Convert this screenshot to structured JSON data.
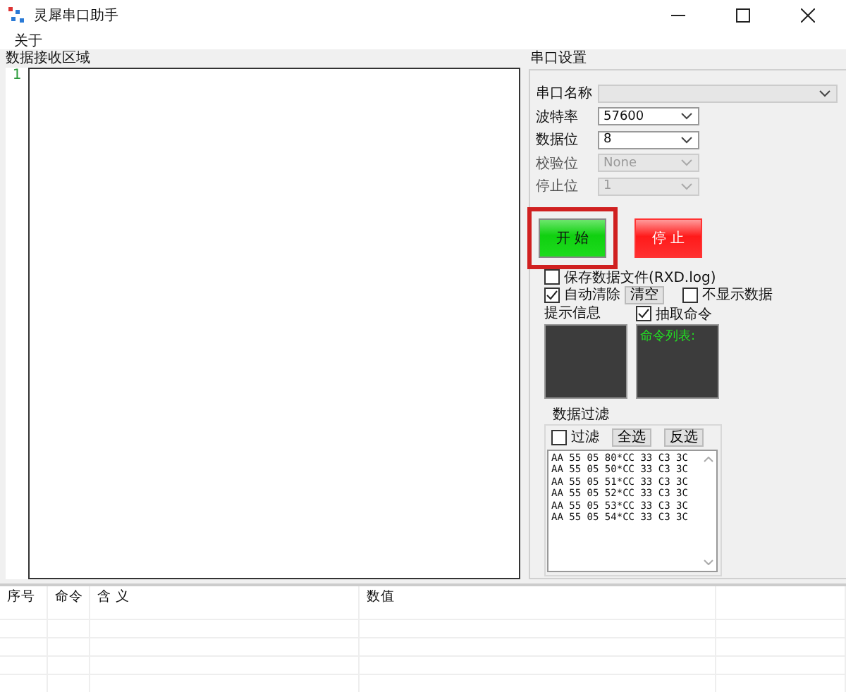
{
  "window": {
    "title": "灵犀串口助手"
  },
  "menu": [
    "关于"
  ],
  "receive": {
    "label": "数据接收区域",
    "line_numbers": [
      "1"
    ]
  },
  "settings": {
    "title": "串口设置",
    "fields": [
      {
        "label": "串口名称",
        "disabled": false,
        "kind": "long"
      },
      {
        "label": "波特率",
        "value": "57600",
        "disabled": false,
        "kind": "short"
      },
      {
        "label": "数据位",
        "value": "8",
        "disabled": false,
        "kind": "short"
      },
      {
        "label": "校验位",
        "value": "None",
        "disabled": true,
        "kind": "short"
      },
      {
        "label": "停止位",
        "value": "1",
        "disabled": true,
        "kind": "short"
      }
    ],
    "buttons": [
      {
        "label": "开  始",
        "kind": "start",
        "highlighted": true
      },
      {
        "label": "停  止",
        "kind": "stop",
        "highlighted": false
      }
    ],
    "save_file": {
      "label": "保存数据文件(RXD.log)",
      "checked": false
    },
    "auto_clear": {
      "label": "自动清除",
      "checked": true
    },
    "clear_button": "清空",
    "hide_data": {
      "label": "不显示数据",
      "checked": false
    },
    "info_label": "提示信息",
    "extract": {
      "label": "抽取命令",
      "checked": true
    },
    "command_list": "命令列表:",
    "filter": {
      "title": "数据过滤",
      "filter_check": {
        "label": "过滤",
        "checked": false
      },
      "buttons": [
        "全选",
        "反选"
      ],
      "lines": [
        "AA 55 05 80*CC 33 C3 3C",
        "AA 55 05 50*CC 33 C3 3C",
        "AA 55 05 51*CC 33 C3 3C",
        "AA 55 05 52*CC 33 C3 3C",
        "AA 55 05 53*CC 33 C3 3C",
        "AA 55 05 54*CC 33 C3 3C"
      ]
    }
  },
  "table": {
    "columns": [
      "序号",
      "命令",
      "含  义",
      "数值"
    ]
  }
}
